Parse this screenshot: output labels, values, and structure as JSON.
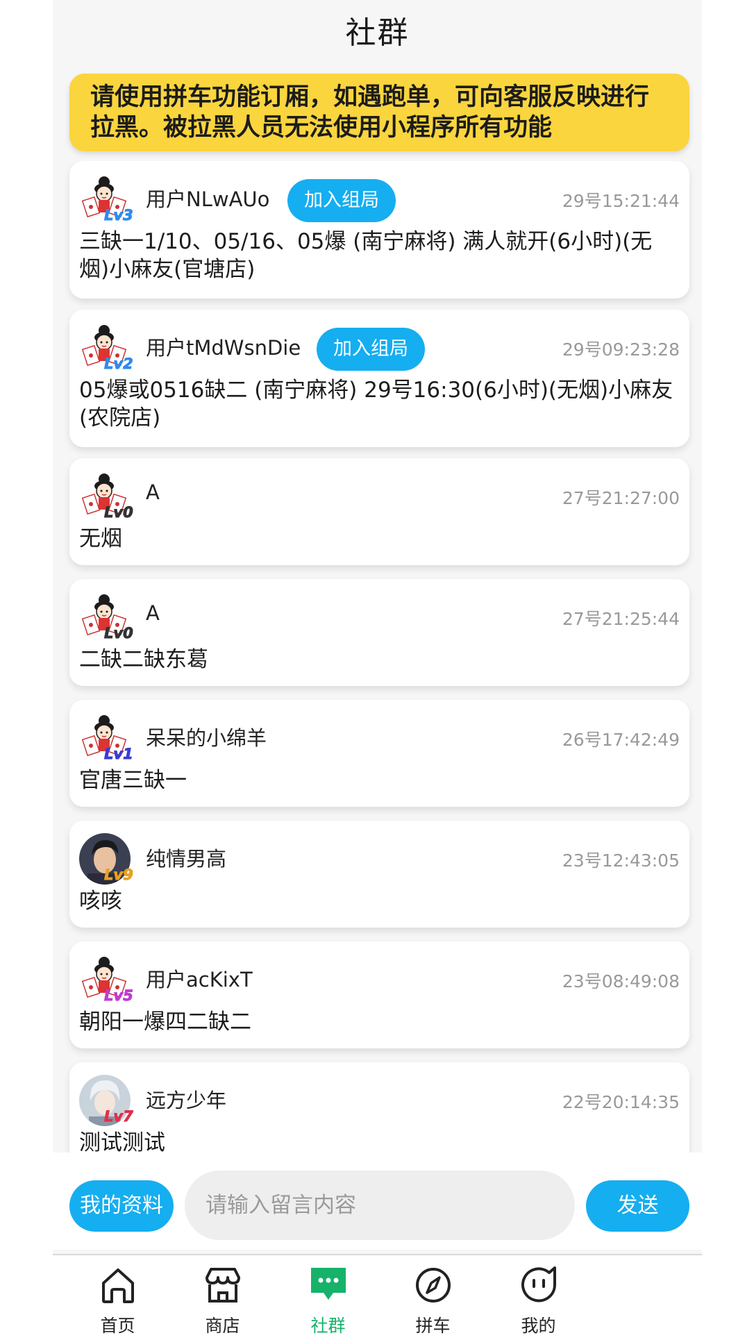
{
  "header": {
    "title": "社群"
  },
  "notice": {
    "text": "请使用拼车功能订厢，如遇跑单，可向客服反映进行拉黑。被拉黑人员无法使用小程序所有功能"
  },
  "posts": [
    {
      "user": "用户NLwAUo",
      "level": "Lv3",
      "level_color": "#2d8cf0",
      "join_label": "加入组局",
      "time": "29号15:21:44",
      "content": "三缺一1/10、05/16、05爆 (南宁麻将) 满人就开(6小时)(无烟)小麻友(官塘店)",
      "avatar": "cartoon-mascot"
    },
    {
      "user": "用户tMdWsnDie",
      "level": "Lv2",
      "level_color": "#2d8cf0",
      "join_label": "加入组局",
      "time": "29号09:23:28",
      "content": "05爆或0516缺二 (南宁麻将) 29号16:30(6小时)(无烟)小麻友(农院店)",
      "avatar": "cartoon-mascot"
    },
    {
      "user": "A",
      "level": "Lv0",
      "level_color": "#333333",
      "time": "27号21:27:00",
      "content": "无烟",
      "avatar": "cartoon-mascot"
    },
    {
      "user": "A",
      "level": "Lv0",
      "level_color": "#333333",
      "time": "27号21:25:44",
      "content": "二缺二缺东葛",
      "avatar": "cartoon-mascot"
    },
    {
      "user": "呆呆的小绵羊",
      "level": "Lv1",
      "level_color": "#3a3ad8",
      "time": "26号17:42:49",
      "content": "官唐三缺一",
      "avatar": "cartoon-mascot"
    },
    {
      "user": "纯情男高",
      "level": "Lv9",
      "level_color": "#e8a020",
      "time": "23号12:43:05",
      "content": "咳咳",
      "avatar": "photo-boy"
    },
    {
      "user": "用户acKixT",
      "level": "Lv5",
      "level_color": "#c03cd0",
      "time": "23号08:49:08",
      "content": "朝阳一爆四二缺二",
      "avatar": "cartoon-mascot"
    },
    {
      "user": "远方少年",
      "level": "Lv7",
      "level_color": "#e0304a",
      "time": "22号20:14:35",
      "content": "测试测试",
      "avatar": "anime-boy"
    }
  ],
  "input_bar": {
    "profile_label": "我的资料",
    "placeholder": "请输入留言内容",
    "send_label": "发送"
  },
  "tabbar": [
    {
      "label": "首页",
      "icon": "home-icon"
    },
    {
      "label": "商店",
      "icon": "store-icon"
    },
    {
      "label": "社群",
      "icon": "chat-icon",
      "active": true
    },
    {
      "label": "拼车",
      "icon": "compass-icon"
    },
    {
      "label": "我的",
      "icon": "face-icon"
    }
  ],
  "colors": {
    "accent_blue": "#15aef0",
    "notice_yellow": "#fad53e",
    "active_green": "#17b26a"
  }
}
